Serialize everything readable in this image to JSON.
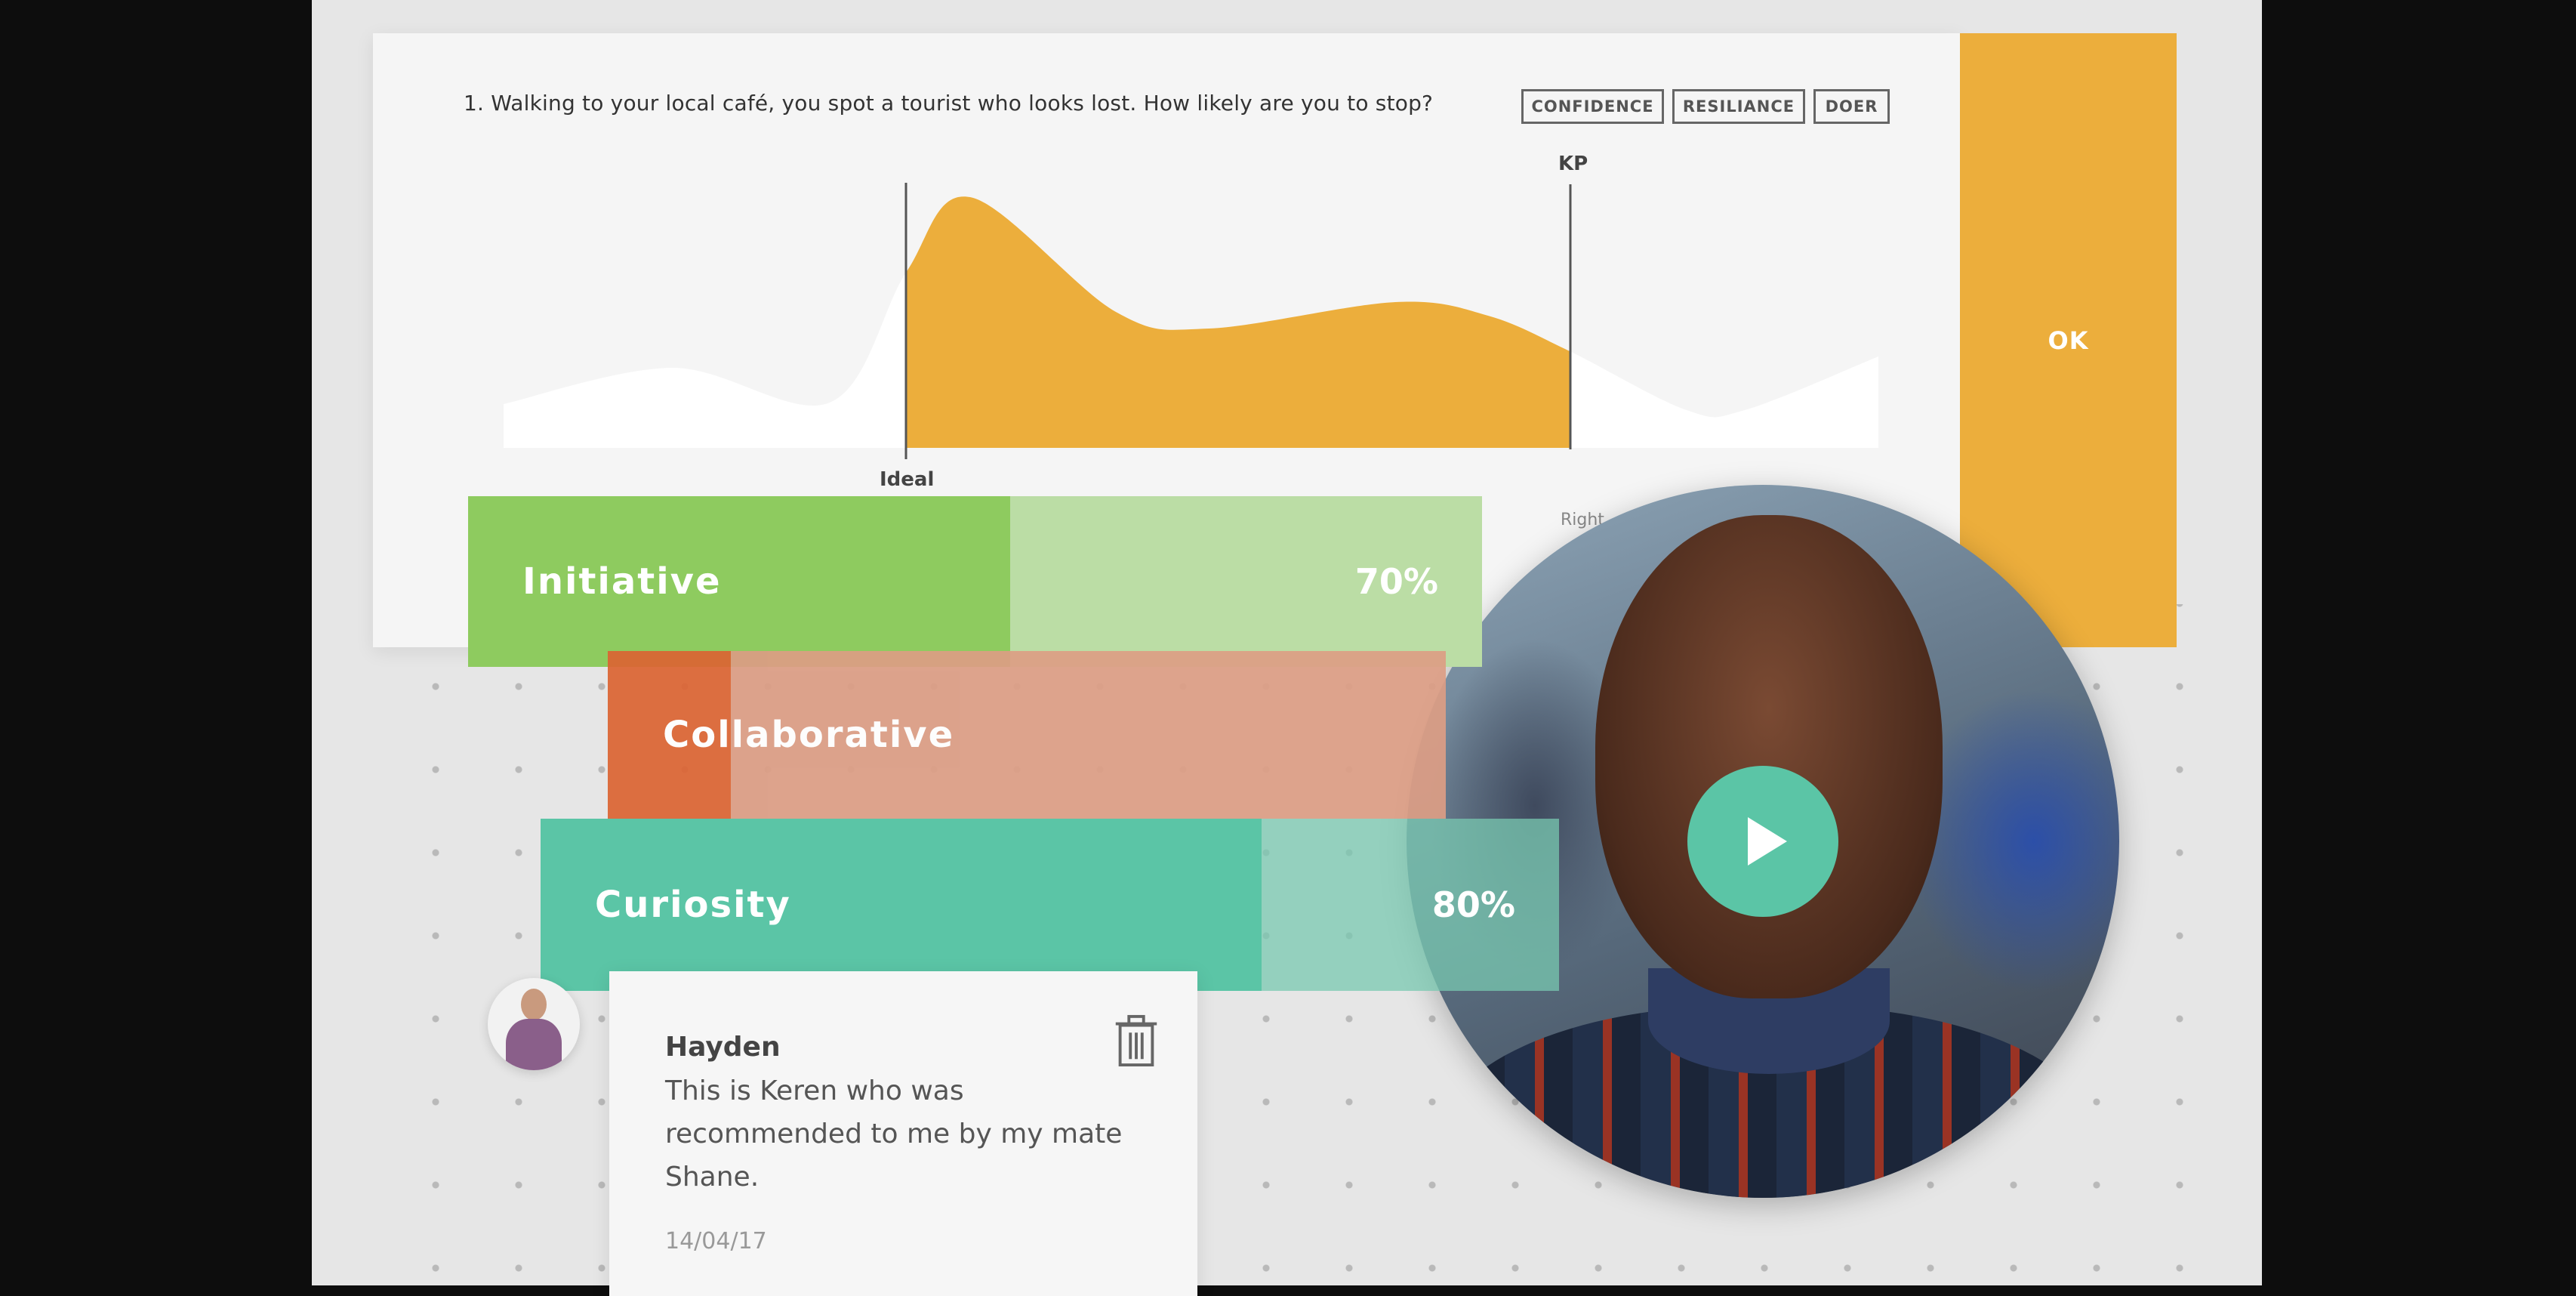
{
  "question": {
    "text": "1.   Walking to your local café, you spot a tourist who looks lost. How likely are you to stop?",
    "tags": [
      "CONFIDENCE",
      "RESILIANCE",
      "DOER"
    ],
    "ok_label": "OK"
  },
  "chart_data": {
    "type": "area",
    "markers": [
      {
        "label": "Ideal"
      },
      {
        "label": "KP"
      }
    ],
    "side_label": "Right",
    "colors": {
      "highlight": "#ecae3c",
      "base": "#ffffff"
    }
  },
  "traits": [
    {
      "label": "Initiative",
      "percent_label": "70%",
      "value": 70,
      "color": "#8ecb5f",
      "light": "#bbdda5"
    },
    {
      "label": "Collaborative",
      "color": "#dc6433",
      "light": "#dc9d84"
    },
    {
      "label": "Curiosity",
      "percent_label": "80%",
      "value": 80,
      "color": "#5bc5a6",
      "light": "#99d1bf"
    }
  ],
  "video": {
    "icon": "play-icon"
  },
  "comment": {
    "author": "Hayden",
    "text": "This is Keren who was recommended to me by my mate Shane.",
    "date": "14/04/17",
    "delete_icon": "trash-icon"
  }
}
